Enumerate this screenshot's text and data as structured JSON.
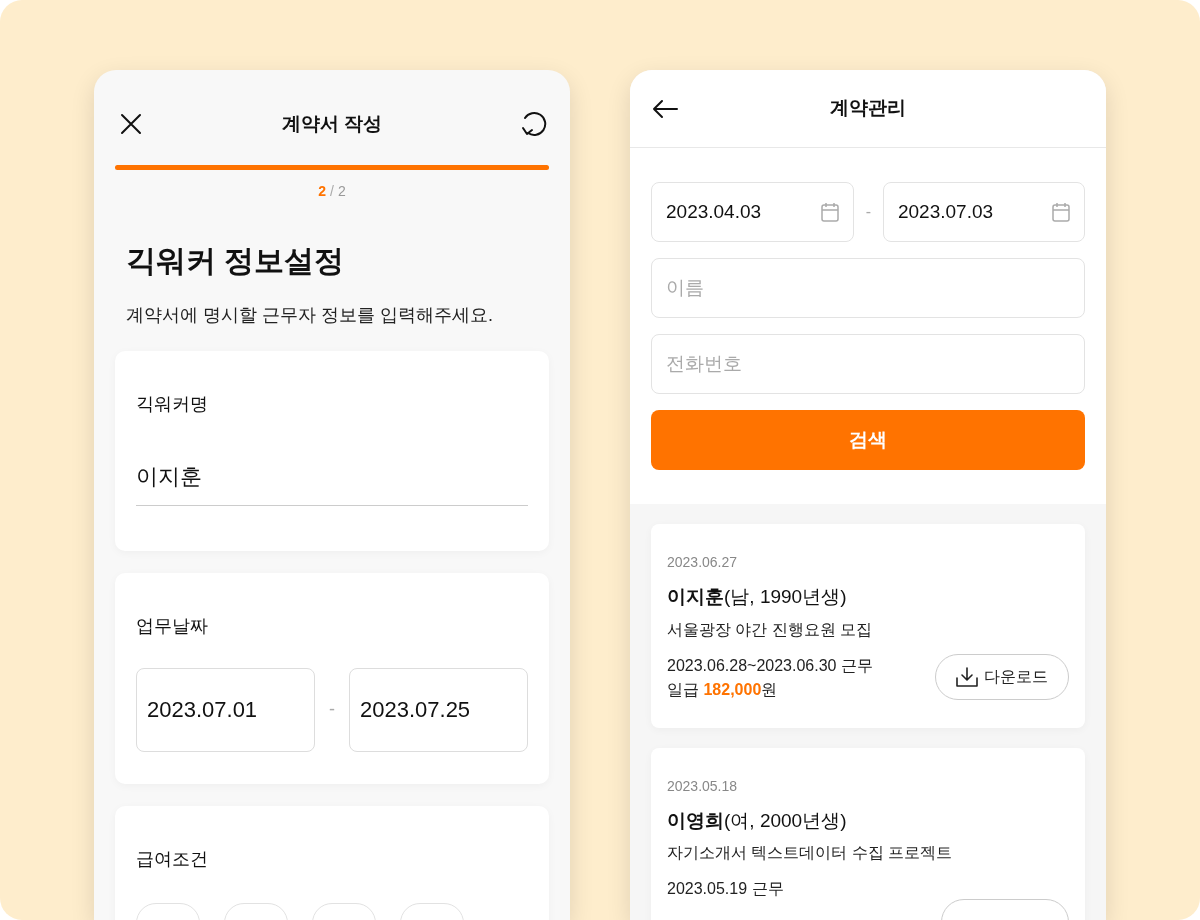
{
  "left_screen": {
    "title": "계약서 작성",
    "progress": {
      "level": 1,
      "current": "2",
      "total": "2",
      "separator": "/"
    },
    "heading": "긱워커 정보설정",
    "description": "계약서에 명시할 근무자 정보를 입력해주세요.",
    "name_card": {
      "label": "긱워커명",
      "value": "이지훈"
    },
    "date_card": {
      "label": "업무날짜",
      "start": "2023.07.01",
      "separator": "-",
      "end": "2023.07.25"
    },
    "pay_card": {
      "label": "급여조건"
    }
  },
  "right_screen": {
    "title": "계약관리",
    "date_range": {
      "start": "2023.04.03",
      "separator": "-",
      "end": "2023.07.03"
    },
    "name_field": {
      "placeholder": "이름"
    },
    "phone_field": {
      "placeholder": "전화번호"
    },
    "search_button": "검색",
    "contracts": [
      {
        "date": "2023.06.27",
        "person": "**이지훈**(남, 1990년생)",
        "job": "서울광장 야간 진행요원 모집",
        "period": "2023.06.28~2023.06.30 근무",
        "wage": "일급 **182,000**원",
        "download": "다운로드"
      },
      {
        "date": "2023.05.18",
        "person": "**이영희**(여, 2000년생)",
        "job": "자기소개서 텍스트데이터 수집 프로젝트",
        "period": "2023.05.19 근무"
      }
    ]
  }
}
